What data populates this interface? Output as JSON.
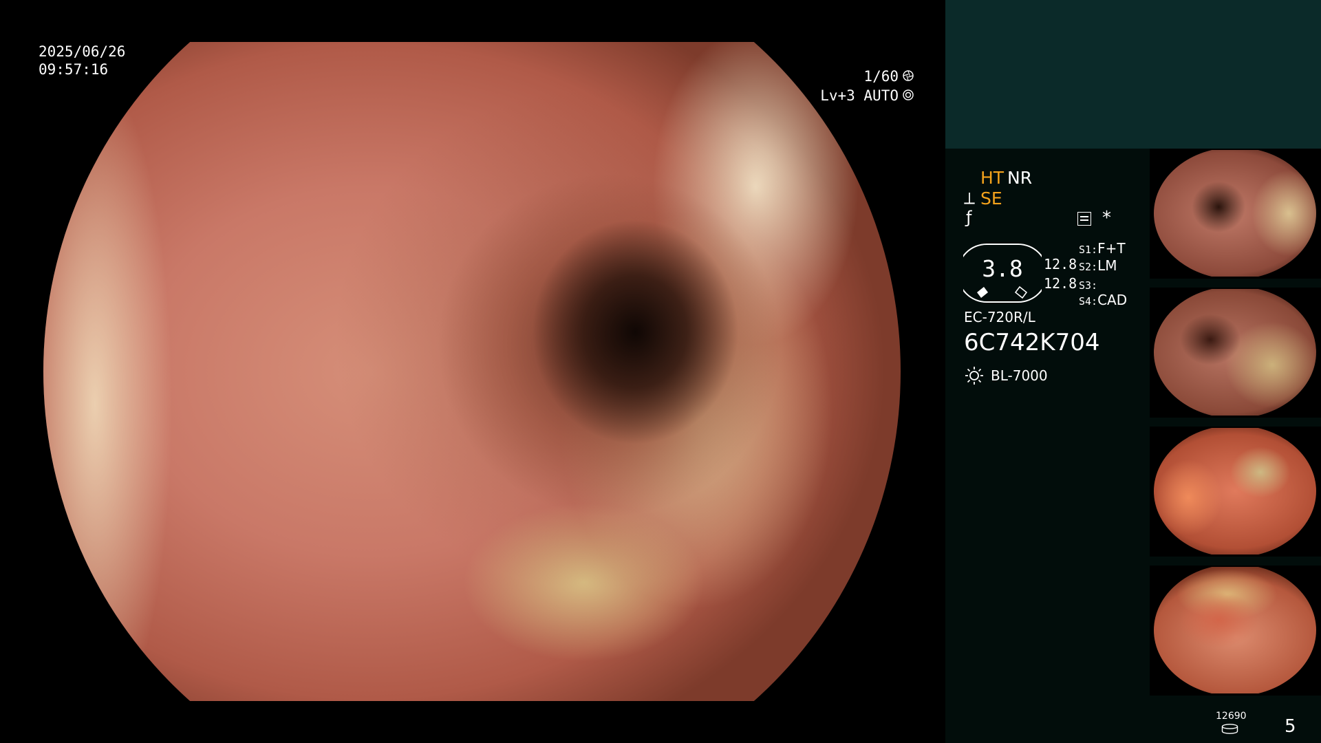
{
  "header": {
    "date": "2025/06/26",
    "time": "09:57:16",
    "shutter": "1/60",
    "shutter_icon": "shutter-icon",
    "level": "Lv+3 AUTO",
    "iris_icon": "iris-icon"
  },
  "status": {
    "mode_ht": "HT",
    "mode_nr": "NR",
    "mode_se": "SE",
    "enhance_icon": "structure-enhance-icon",
    "freeze_icon": "freeze-icon",
    "record_icon": "record-list-icon",
    "star": "*",
    "zoom_value": "3.8",
    "value_a": "12.8",
    "value_b": "12.8",
    "switches": [
      {
        "key": "S1:",
        "value": "F+T"
      },
      {
        "key": "S2:",
        "value": "LM"
      },
      {
        "key": "S3:",
        "value": ""
      },
      {
        "key": "S4:",
        "value": "CAD"
      }
    ],
    "scope_model": "EC-720R/L",
    "scope_serial": "6C742K704",
    "light_icon": "light-source-icon",
    "light_source": "BL-7000"
  },
  "footer": {
    "storage_count": "12690",
    "storage_icon": "storage-icon",
    "page_number": "5"
  },
  "colors": {
    "accent_orange": "#f5a31c",
    "panel_top": "#0b2a29",
    "panel_bg": "#020d0b"
  }
}
